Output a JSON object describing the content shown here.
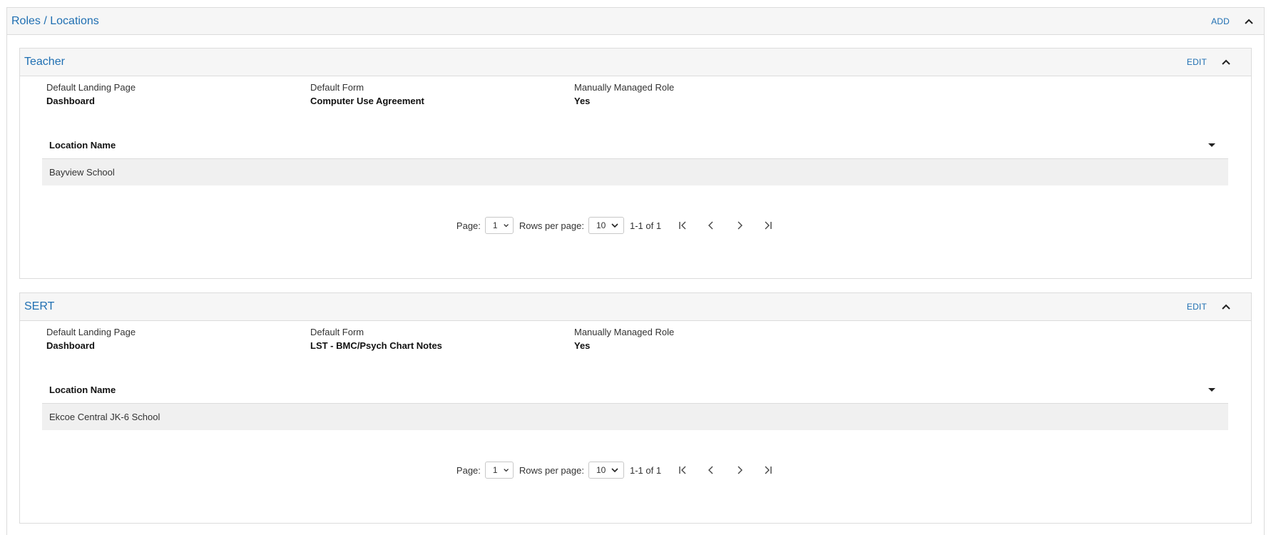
{
  "section": {
    "title": "Roles / Locations",
    "add_label": "ADD"
  },
  "roles": [
    {
      "title": "Teacher",
      "edit_label": "EDIT",
      "props": [
        {
          "label": "Default Landing Page",
          "value": "Dashboard"
        },
        {
          "label": "Default Form",
          "value": "Computer Use Agreement"
        },
        {
          "label": "Manually Managed Role",
          "value": "Yes"
        }
      ],
      "table": {
        "header": "Location Name",
        "rows": [
          "Bayview School"
        ]
      },
      "pager": {
        "page_label": "Page:",
        "page_value": "1",
        "rows_label": "Rows per page:",
        "rows_value": "10",
        "range": "1-1 of 1"
      }
    },
    {
      "title": "SERT",
      "edit_label": "EDIT",
      "props": [
        {
          "label": "Default Landing Page",
          "value": "Dashboard"
        },
        {
          "label": "Default Form",
          "value": "LST - BMC/Psych Chart Notes"
        },
        {
          "label": "Manually Managed Role",
          "value": "Yes"
        }
      ],
      "table": {
        "header": "Location Name",
        "rows": [
          "Ekcoe Central JK-6 School"
        ]
      },
      "pager": {
        "page_label": "Page:",
        "page_value": "1",
        "rows_label": "Rows per page:",
        "rows_value": "10",
        "range": "1-1 of 1"
      }
    }
  ],
  "colors": {
    "accent": "#1f6fb2",
    "header_bg": "#f6f6f6",
    "row_bg": "#f0f0f0",
    "border": "#dcdcdc"
  }
}
